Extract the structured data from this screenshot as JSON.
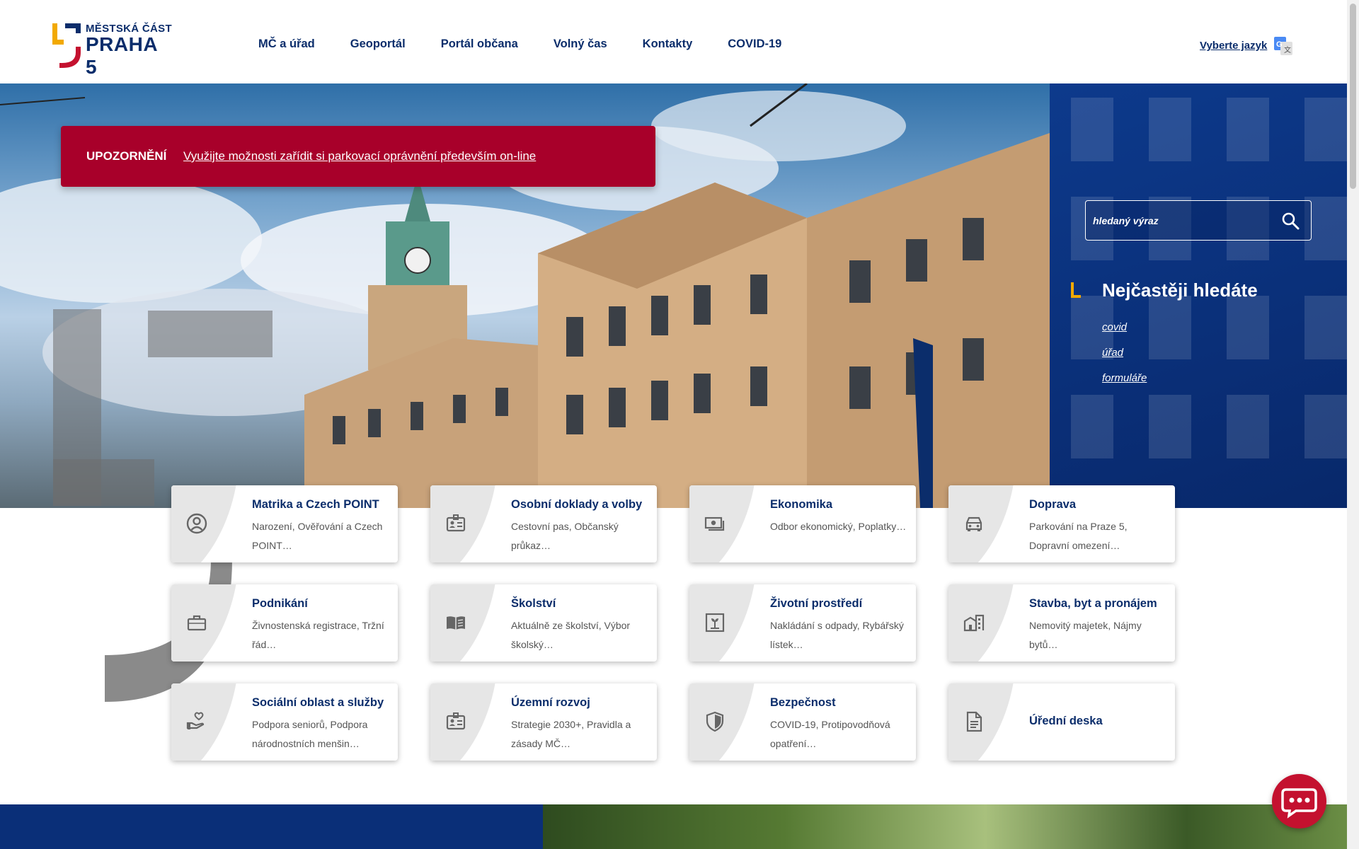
{
  "header": {
    "logo_top": "MĚSTSKÁ ČÁST",
    "logo_main": "PRAHA 5",
    "nav": [
      "MČ a úřad",
      "Geoportál",
      "Portál občana",
      "Volný čas",
      "Kontakty",
      "COVID-19"
    ],
    "language_link": "Vyberte jazyk"
  },
  "alert": {
    "label": "UPOZORNĚNÍ",
    "link": "Využijte možnosti zařídit si parkovací oprávnění především on-line"
  },
  "search": {
    "placeholder": "hledaný výraz"
  },
  "frequent": {
    "title": "Nejčastěji hledáte",
    "links": [
      "covid",
      "úřad",
      "formuláře"
    ]
  },
  "cards": [
    {
      "title": "Matrika a Czech POINT",
      "desc": "Narození, Ověřování a Czech POINT…",
      "icon": "user-circle-icon"
    },
    {
      "title": "Osobní doklady a volby",
      "desc": "Cestovní pas, Občanský průkaz…",
      "icon": "id-card-icon"
    },
    {
      "title": "Ekonomika",
      "desc": "Odbor ekonomický, Poplatky…",
      "icon": "money-icon"
    },
    {
      "title": "Doprava",
      "desc": "Parkování na Praze 5, Dopravní omezení…",
      "icon": "car-icon"
    },
    {
      "title": "Podnikání",
      "desc": "Živnostenská registrace, Tržní řád…",
      "icon": "briefcase-icon"
    },
    {
      "title": "Školství",
      "desc": "Aktuálně ze školství, Výbor školský…",
      "icon": "book-icon"
    },
    {
      "title": "Životní prostředí",
      "desc": "Nakládání s odpady, Rybářský lístek…",
      "icon": "plant-icon"
    },
    {
      "title": "Stavba, byt a pronájem",
      "desc": "Nemovitý majetek, Nájmy bytů…",
      "icon": "buildings-icon"
    },
    {
      "title": "Sociální oblast a služby",
      "desc": "Podpora seniorů, Podpora národnostních menšin…",
      "icon": "hand-heart-icon"
    },
    {
      "title": "Územní rozvoj",
      "desc": "Strategie 2030+, Pravidla a zásady MČ…",
      "icon": "id-card-icon"
    },
    {
      "title": "Bezpečnost",
      "desc": "COVID-19, Protipovodňová opatření…",
      "icon": "shield-icon"
    },
    {
      "title": "Úřední deska",
      "desc": "",
      "icon": "document-icon"
    }
  ],
  "colors": {
    "brand_blue": "#0b2d6b",
    "alert_red": "#a8002a",
    "accent_yellow": "#f2a900",
    "chat_red": "#c4112f"
  }
}
